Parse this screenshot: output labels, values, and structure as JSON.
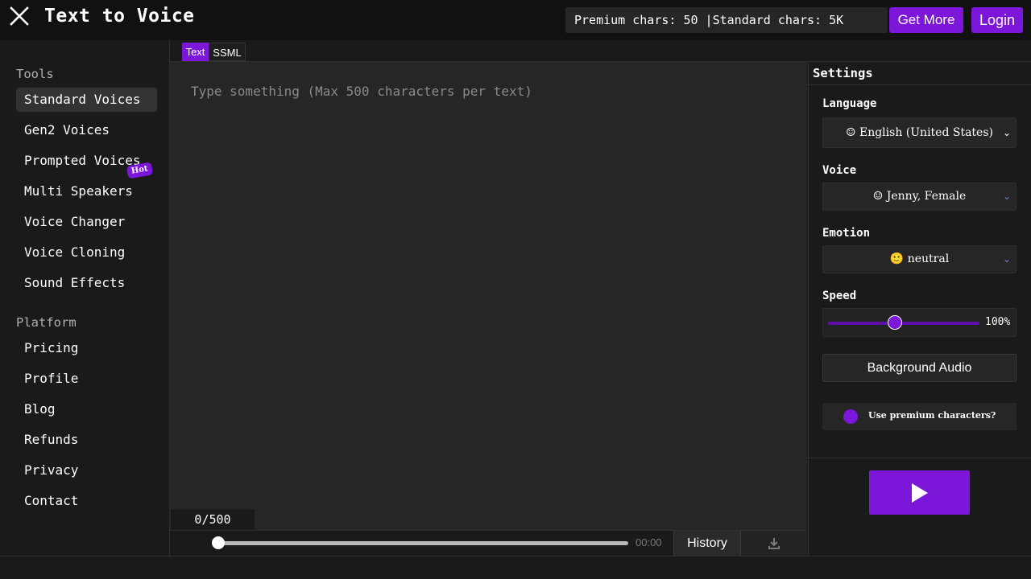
{
  "header": {
    "title": "Text to Voice",
    "chars_info": "Premium chars: 50 |Standard chars: 5K",
    "get_more_label": "Get More",
    "login_label": "Login"
  },
  "sidebar": {
    "tools_heading": "Tools",
    "tools": [
      {
        "label": "Standard Voices",
        "active": true
      },
      {
        "label": "Gen2 Voices"
      },
      {
        "label": "Prompted Voices",
        "badge": "Hot"
      },
      {
        "label": "Multi Speakers"
      },
      {
        "label": "Voice Changer"
      },
      {
        "label": "Voice Cloning"
      },
      {
        "label": "Sound Effects"
      }
    ],
    "platform_heading": "Platform",
    "platform": [
      {
        "label": "Pricing"
      },
      {
        "label": "Profile"
      },
      {
        "label": "Blog"
      },
      {
        "label": "Refunds"
      },
      {
        "label": "Privacy"
      },
      {
        "label": "Contact"
      }
    ]
  },
  "tabs": [
    {
      "label": "Text",
      "active": true
    },
    {
      "label": "SSML"
    }
  ],
  "editor": {
    "placeholder": "Type something (Max 500 characters per text)",
    "value": "",
    "counter": "0/500"
  },
  "player": {
    "progress": 0,
    "time": "00:00",
    "history_label": "History"
  },
  "settings": {
    "title": "Settings",
    "language_label": "Language",
    "language_value": "☺ English (United States)",
    "voice_label": "Voice",
    "voice_value": "☺ Jenny, Female",
    "emotion_label": "Emotion",
    "emotion_value": "🙂 neutral",
    "speed_label": "Speed",
    "speed_value": "100%",
    "speed_level": 0.44,
    "background_audio_label": "Background Audio",
    "premium_toggle_label": "Use premium characters?"
  },
  "colors": {
    "accent": "#7c16d8",
    "background": "#1e1e1e",
    "panel": "#1a1a1a",
    "editor": "#262626"
  }
}
